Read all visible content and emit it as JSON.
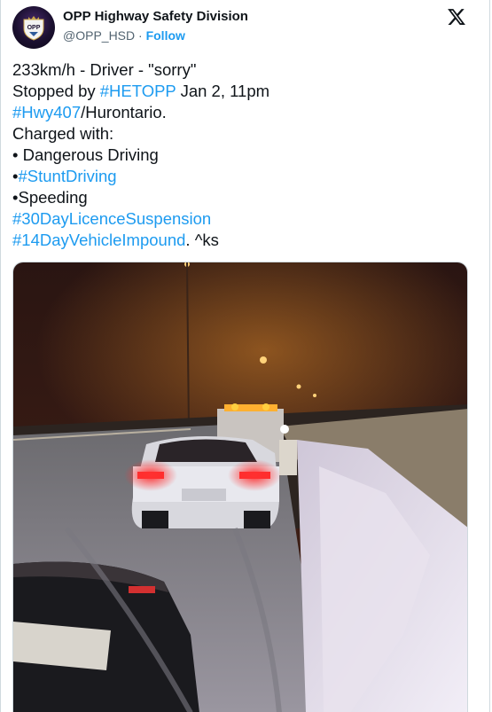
{
  "author": {
    "display_name": "OPP Highway Safety Division",
    "handle": "@OPP_HSD",
    "separator": "·",
    "follow_label": "Follow",
    "avatar_text": "OPP"
  },
  "tweet": {
    "line1": "233km/h - Driver - \"sorry\"",
    "line2_prefix": "Stopped by ",
    "line2_tag": "#HETOPP",
    "line2_suffix": " Jan 2, 11pm",
    "line3_tag": "#Hwy407",
    "line3_suffix": "/Hurontario.",
    "line4": "Charged with:",
    "line5": "• Dangerous Driving",
    "line6_bullet": "•",
    "line6_tag": "#StuntDriving",
    "line7": "•Speeding",
    "line8_tag": "#30DayLicenceSuspension",
    "line9_tag": "#14DayVehicleImpound",
    "line9_suffix": ". ^ks"
  },
  "colors": {
    "link": "#1d9bf0",
    "text": "#0f1419",
    "secondary": "#536471"
  },
  "icons": {
    "platform_logo": "x-logo-icon"
  }
}
